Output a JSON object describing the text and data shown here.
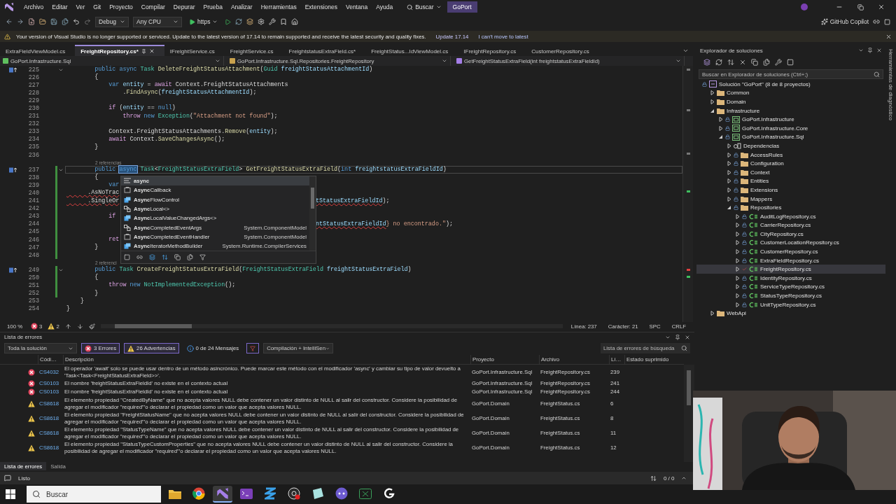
{
  "menu": {
    "items": [
      "Archivo",
      "Editar",
      "Ver",
      "Git",
      "Proyecto",
      "Compilar",
      "Depurar",
      "Prueba",
      "Analizar",
      "Herramientas",
      "Extensiones",
      "Ventana",
      "Ayuda"
    ],
    "search": "Buscar",
    "solution": "GoPort"
  },
  "toolbar": {
    "configuration": "Debug",
    "platform": "Any CPU",
    "run_target": "https",
    "copilot": "GitHub Copilot"
  },
  "info_bar": {
    "message": "Your version of Visual Studio is no longer supported or serviced. Update to the latest version of 17.14 to remain supported and receive the latest security and quality fixes.",
    "links": [
      "Update 17.14",
      "I can't move to latest"
    ]
  },
  "editor": {
    "tabs": [
      {
        "label": "ExtraFieldViewModel.cs",
        "selected": false
      },
      {
        "label": "FreightRepository.cs*",
        "selected": true
      },
      {
        "label": "IFreightService.cs",
        "selected": false
      },
      {
        "label": "FreightService.cs",
        "selected": false
      },
      {
        "label": "FreightstatusExtraField.cs*",
        "selected": false
      },
      {
        "label": "FreightStatus...IdViewModel.cs",
        "selected": false
      },
      {
        "label": "IFreightRepository.cs",
        "selected": false
      },
      {
        "label": "CustomerRepository.cs",
        "selected": false
      }
    ],
    "navigation": {
      "project": "GoPort.Infrastructure.Sql",
      "type": "GoPort.Infrastructure.Sql.Repositories.FreightRepository",
      "member": "GetFreightStatusExtraField(int freightstatusExtraFieldId)"
    },
    "lines": [
      {
        "kind": "code",
        "number": "225",
        "foldable": true,
        "changed": false,
        "current": false,
        "segments": [
          {
            "text": "        public async ",
            "kind": "kw"
          },
          {
            "text": "Task ",
            "kind": "type"
          },
          {
            "text": "DeleteFreightStatusAttachment",
            "kind": "method"
          },
          {
            "text": "(",
            "kind": "plain"
          },
          {
            "text": "Guid ",
            "kind": "type"
          },
          {
            "text": "freightStatusAttachmentId",
            "kind": "param"
          },
          {
            "text": ")",
            "kind": "plain"
          }
        ]
      },
      {
        "kind": "code",
        "number": "226",
        "foldable": false,
        "changed": false,
        "current": false,
        "segments": [
          {
            "text": "        {",
            "kind": "plain"
          }
        ]
      },
      {
        "kind": "code",
        "number": "227",
        "foldable": false,
        "changed": false,
        "current": false,
        "segments": [
          {
            "text": "            var ",
            "kind": "kw"
          },
          {
            "text": "entity",
            "kind": "param"
          },
          {
            "text": " = ",
            "kind": "plain"
          },
          {
            "text": "await ",
            "kind": "ctrl"
          },
          {
            "text": "Context.FreightStatusAttachments",
            "kind": "plain"
          }
        ]
      },
      {
        "kind": "code",
        "number": "228",
        "foldable": false,
        "changed": false,
        "current": false,
        "segments": [
          {
            "text": "                .",
            "kind": "plain"
          },
          {
            "text": "FindAsync",
            "kind": "method"
          },
          {
            "text": "(",
            "kind": "plain"
          },
          {
            "text": "freightStatusAttachmentId",
            "kind": "param"
          },
          {
            "text": ");",
            "kind": "plain"
          }
        ]
      },
      {
        "kind": "code",
        "number": "229",
        "foldable": false,
        "changed": false,
        "current": false
      },
      {
        "kind": "code",
        "number": "230",
        "foldable": false,
        "changed": false,
        "current": false,
        "segments": [
          {
            "text": "            if ",
            "kind": "ctrl"
          },
          {
            "text": "(",
            "kind": "plain"
          },
          {
            "text": "entity",
            "kind": "param"
          },
          {
            "text": " == ",
            "kind": "plain"
          },
          {
            "text": "null",
            "kind": "kw"
          },
          {
            "text": ")",
            "kind": "plain"
          }
        ]
      },
      {
        "kind": "code",
        "number": "231",
        "foldable": false,
        "changed": false,
        "current": false,
        "segments": [
          {
            "text": "                throw ",
            "kind": "ctrl"
          },
          {
            "text": "new ",
            "kind": "kw"
          },
          {
            "text": "Exception",
            "kind": "type"
          },
          {
            "text": "(",
            "kind": "plain"
          },
          {
            "text": "\"Attachment not found\"",
            "kind": "str"
          },
          {
            "text": ");",
            "kind": "plain"
          }
        ]
      },
      {
        "kind": "code",
        "number": "232",
        "foldable": false,
        "changed": false,
        "current": false
      },
      {
        "kind": "code",
        "number": "233",
        "foldable": false,
        "changed": false,
        "current": false,
        "segments": [
          {
            "text": "            Context.FreightStatusAttachments.",
            "kind": "plain"
          },
          {
            "text": "Remove",
            "kind": "method"
          },
          {
            "text": "(",
            "kind": "plain"
          },
          {
            "text": "entity",
            "kind": "param"
          },
          {
            "text": ");",
            "kind": "plain"
          }
        ]
      },
      {
        "kind": "code",
        "number": "234",
        "foldable": false,
        "changed": false,
        "current": false,
        "segments": [
          {
            "text": "            await ",
            "kind": "ctrl"
          },
          {
            "text": "Context.",
            "kind": "plain"
          },
          {
            "text": "SaveChangesAsync",
            "kind": "method"
          },
          {
            "text": "();",
            "kind": "plain"
          }
        ]
      },
      {
        "kind": "code",
        "number": "235",
        "foldable": false,
        "changed": false,
        "current": false,
        "segments": [
          {
            "text": "        }",
            "kind": "plain"
          }
        ]
      },
      {
        "kind": "code",
        "number": "236",
        "foldable": false,
        "changed": false,
        "current": false
      },
      {
        "kind": "codelens",
        "text": "2 referencias"
      },
      {
        "kind": "code",
        "number": "237",
        "foldable": true,
        "changed": true,
        "current": true,
        "segments": [
          {
            "text": "        public ",
            "kind": "kw"
          },
          {
            "text": "async",
            "kind": "selection"
          },
          {
            "text": " Task",
            "kind": "type"
          },
          {
            "text": "<",
            "kind": "plain"
          },
          {
            "text": "FreightStatusExtraField",
            "kind": "type"
          },
          {
            "text": "> ",
            "kind": "plain"
          },
          {
            "text": "GetFreightStatusExtraField",
            "kind": "method"
          },
          {
            "text": "(",
            "kind": "plain"
          },
          {
            "text": "int ",
            "kind": "kw"
          },
          {
            "text": "freightstatusExtraFieldId",
            "kind": "param"
          },
          {
            "text": ")",
            "kind": "plain"
          }
        ]
      },
      {
        "kind": "code",
        "number": "238",
        "foldable": false,
        "changed": true,
        "current": false,
        "segments": [
          {
            "text": "        {",
            "kind": "plain"
          }
        ]
      },
      {
        "kind": "code",
        "number": "239",
        "foldable": false,
        "changed": true,
        "current": false,
        "segments": [
          {
            "text": "            var",
            "kind": "kw"
          }
        ]
      },
      {
        "kind": "code",
        "number": "240",
        "foldable": false,
        "changed": true,
        "current": false,
        "segments": [
          {
            "text": "      .AsNoTrac",
            "kind": "error"
          }
        ]
      },
      {
        "kind": "code",
        "number": "241",
        "foldable": false,
        "changed": true,
        "current": false,
        "segments": [
          {
            "text": "      .SingleOr",
            "kind": "error"
          }
        ],
        "after_popup": [
          {
            "text": "tStatusExtraFieldId",
            "kind": "error-param"
          },
          {
            "text": ");",
            "kind": "plain"
          }
        ]
      },
      {
        "kind": "code",
        "number": "242",
        "foldable": false,
        "changed": true,
        "current": false
      },
      {
        "kind": "code",
        "number": "243",
        "foldable": false,
        "changed": true,
        "current": false,
        "segments": [
          {
            "text": "            if",
            "kind": "ctrl"
          }
        ]
      },
      {
        "kind": "code",
        "number": "244",
        "foldable": false,
        "changed": true,
        "current": false,
        "after_popup": [
          {
            "text": "ntStatusExtraFieldId",
            "kind": "error-param"
          },
          {
            "text": "} no encontrado.\"",
            "kind": "str"
          },
          {
            "text": ");",
            "kind": "plain"
          }
        ]
      },
      {
        "kind": "code",
        "number": "245",
        "foldable": false,
        "changed": true,
        "current": false
      },
      {
        "kind": "code",
        "number": "246",
        "foldable": false,
        "changed": true,
        "current": false,
        "segments": [
          {
            "text": "            ret",
            "kind": "ctrl"
          }
        ]
      },
      {
        "kind": "code",
        "number": "247",
        "foldable": false,
        "changed": true,
        "current": false,
        "segments": [
          {
            "text": "        }",
            "kind": "plain"
          }
        ]
      },
      {
        "kind": "code",
        "number": "248",
        "foldable": false,
        "changed": true,
        "current": false
      },
      {
        "kind": "codelens",
        "text": "2 referenci"
      },
      {
        "kind": "code",
        "number": "249",
        "foldable": true,
        "changed": true,
        "current": false,
        "segments": [
          {
            "text": "        public ",
            "kind": "kw"
          },
          {
            "text": "Task ",
            "kind": "type"
          },
          {
            "text": "CreateFreightStatusExtraField",
            "kind": "method"
          },
          {
            "text": "(",
            "kind": "plain"
          },
          {
            "text": "FreightStatusExtraField ",
            "kind": "type"
          },
          {
            "text": "freightStatusExtraField",
            "kind": "param"
          },
          {
            "text": ")",
            "kind": "plain"
          }
        ]
      },
      {
        "kind": "code",
        "number": "250",
        "foldable": false,
        "changed": true,
        "current": false,
        "segments": [
          {
            "text": "        {",
            "kind": "plain"
          }
        ]
      },
      {
        "kind": "code",
        "number": "251",
        "foldable": false,
        "changed": true,
        "current": false,
        "segments": [
          {
            "text": "            throw ",
            "kind": "ctrl"
          },
          {
            "text": "new ",
            "kind": "kw"
          },
          {
            "text": "NotImplementedException",
            "kind": "type"
          },
          {
            "text": "();",
            "kind": "plain"
          }
        ]
      },
      {
        "kind": "code",
        "number": "252",
        "foldable": false,
        "changed": true,
        "current": false,
        "segments": [
          {
            "text": "        }",
            "kind": "plain"
          }
        ]
      },
      {
        "kind": "code",
        "number": "253",
        "foldable": false,
        "changed": false,
        "current": false,
        "segments": [
          {
            "text": "    }",
            "kind": "plain"
          }
        ]
      },
      {
        "kind": "code",
        "number": "254",
        "foldable": false,
        "changed": false,
        "current": false,
        "segments": [
          {
            "text": "}",
            "kind": "plain"
          }
        ]
      }
    ],
    "completion": {
      "items": [
        {
          "name": "**async**",
          "kind": "keyword",
          "selected": true
        },
        {
          "name": "**Async**Callback",
          "kind": "delegate",
          "selected": false
        },
        {
          "name": "**Async**FlowControl",
          "kind": "struct",
          "selected": false
        },
        {
          "name": "**Async**Local<>",
          "kind": "class",
          "selected": false
        },
        {
          "name": "**Async**LocalValueChangedArgs<>",
          "kind": "struct",
          "selected": false
        },
        {
          "name": "**Async**CompletedEventArgs",
          "kind": "class",
          "selected": false,
          "namespace": "System.ComponentModel"
        },
        {
          "name": "**Async**CompletedEventHandler",
          "kind": "delegate",
          "selected": false,
          "namespace": "System.ComponentModel"
        },
        {
          "name": "**Async**IteratorMethodBuilder",
          "kind": "struct",
          "selected": false,
          "namespace": "System.Runtime.CompilerServices"
        }
      ]
    },
    "status": {
      "zoom": "100 %",
      "errors": "3",
      "warnings": "2",
      "line": "Línea: 237",
      "column": "Carácter: 21",
      "indent": "SPC",
      "line_ending": "CRLF"
    }
  },
  "solution_explorer": {
    "title": "Explorador de soluciones",
    "search_placeholder": "Buscar en Explorador de soluciones (Ctrl+;)",
    "root": {
      "label": "Solución \"GoPort\" (8 de 8 proyectos)",
      "kind": "solution",
      "checked_in": true,
      "selected": false,
      "children": [
        {
          "label": "Common",
          "kind": "folder",
          "expanded": false,
          "selected": false
        },
        {
          "label": "Domain",
          "kind": "folder",
          "expanded": false,
          "selected": false
        },
        {
          "label": "Infrastructure",
          "kind": "folder",
          "expanded": true,
          "selected": false,
          "children": [
            {
              "label": "GoPort.Infrastructure",
              "kind": "project",
              "checked_in": true,
              "expanded": false,
              "selected": false
            },
            {
              "label": "GoPort.Infrastructure.Core",
              "kind": "project",
              "checked_in": true,
              "expanded": false,
              "selected": false
            },
            {
              "label": "GoPort.Infrastructure.Sql",
              "kind": "project",
              "checked_in": true,
              "expanded": true,
              "selected": false,
              "children": [
                {
                  "label": "Dependencias",
                  "kind": "dependencies",
                  "expanded": false,
                  "selected": false
                },
                {
                  "label": "AccessRules",
                  "kind": "folder",
                  "checked_in": true,
                  "expanded": false,
                  "selected": false
                },
                {
                  "label": "Configuration",
                  "kind": "folder",
                  "checked_in": true,
                  "expanded": false,
                  "selected": false
                },
                {
                  "label": "Context",
                  "kind": "folder",
                  "checked_in": true,
                  "expanded": false,
                  "selected": false
                },
                {
                  "label": "Entities",
                  "kind": "folder",
                  "checked_in": true,
                  "expanded": false,
                  "selected": false
                },
                {
                  "label": "Extensions",
                  "kind": "folder",
                  "checked_in": true,
                  "expanded": false,
                  "selected": false
                },
                {
                  "label": "Mappers",
                  "kind": "folder",
                  "checked_in": true,
                  "expanded": false,
                  "selected": false
                },
                {
                  "label": "Repositories",
                  "kind": "folder",
                  "checked_in": true,
                  "expanded": true,
                  "selected": false,
                  "children": [
                    {
                      "label": "AuditLogRepository.cs",
                      "kind": "csharp",
                      "checked_in": true,
                      "expanded": false,
                      "selected": false
                    },
                    {
                      "label": "CarrierRepository.cs",
                      "kind": "csharp",
                      "checked_in": true,
                      "expanded": false,
                      "selected": false
                    },
                    {
                      "label": "CityRepository.cs",
                      "kind": "csharp",
                      "checked_in": true,
                      "expanded": false,
                      "selected": false
                    },
                    {
                      "label": "CustomerLocationRepository.cs",
                      "kind": "csharp",
                      "checked_in": true,
                      "expanded": false,
                      "selected": false
                    },
                    {
                      "label": "CustomerRepository.cs",
                      "kind": "csharp",
                      "checked_in": true,
                      "expanded": false,
                      "selected": false
                    },
                    {
                      "label": "ExtraFieldRepository.cs",
                      "kind": "csharp",
                      "checked_in": true,
                      "expanded": false,
                      "selected": false
                    },
                    {
                      "label": "FreightRepository.cs",
                      "kind": "csharp",
                      "checked_in": false,
                      "expanded": false,
                      "selected": true
                    },
                    {
                      "label": "IdentityRepository.cs",
                      "kind": "csharp",
                      "checked_in": true,
                      "expanded": false,
                      "selected": false
                    },
                    {
                      "label": "ServiceTypeRepository.cs",
                      "kind": "csharp",
                      "checked_in": true,
                      "expanded": false,
                      "selected": false
                    },
                    {
                      "label": "StatusTypeRepository.cs",
                      "kind": "csharp",
                      "checked_in": true,
                      "expanded": false,
                      "selected": false
                    },
                    {
                      "label": "UnitTypeRepository.cs",
                      "kind": "csharp",
                      "checked_in": true,
                      "expanded": false,
                      "selected": false
                    }
                  ]
                }
              ]
            }
          ]
        },
        {
          "label": "WebApi",
          "kind": "folder",
          "expanded": false,
          "selected": false
        }
      ]
    }
  },
  "side_strip": {
    "label": "Herramientas de diagnóstico"
  },
  "error_list": {
    "title": "Lista de errores",
    "scope": "Toda la solución",
    "filters": [
      {
        "label": "3 Errores",
        "kind": "error",
        "selected": true
      },
      {
        "label": "26 Advertencias",
        "kind": "warning",
        "selected": true
      },
      {
        "label": "0 de 24 Mensajes",
        "kind": "info",
        "selected": false
      }
    ],
    "source": "Compilación + IntelliSen",
    "search_placeholder": "Lista de errores de búsqueda",
    "columns": [
      "Códi…",
      "Descripción",
      "Proyecto",
      "Archivo",
      "Lí…",
      "Estado suprimido"
    ],
    "rows": [
      {
        "kind": "error",
        "code": "CS4032",
        "description": "El operador 'await' solo se puede usar dentro de un método asincrónico. Puede marcar este método con el modificador 'async' y cambiar su tipo de valor devuelto a 'Task<Task<FreightStatusExtraField>>'.",
        "project": "GoPort.Infrastructure.Sql",
        "file": "FreightRepository.cs",
        "line": "239"
      },
      {
        "kind": "error",
        "code": "CS0103",
        "description": "El nombre 'freightStatusExtraFieldId' no existe en el contexto actual",
        "project": "GoPort.Infrastructure.Sql",
        "file": "FreightRepository.cs",
        "line": "241"
      },
      {
        "kind": "error",
        "code": "CS0103",
        "description": "El nombre 'freightStatusExtraFieldId' no existe en el contexto actual",
        "project": "GoPort.Infrastructure.Sql",
        "file": "FreightRepository.cs",
        "line": "244"
      },
      {
        "kind": "warning",
        "code": "CS8618",
        "description": "El elemento propiedad \"CreatedByName\" que no acepta valores NULL debe contener un valor distinto de NULL al salir del constructor. Considere la posibilidad de agregar el modificador \"required\"'o declarar el propiedad como un valor que acepta valores NULL.",
        "project": "GoPort.Domain",
        "file": "FreightStatus.cs",
        "line": "6"
      },
      {
        "kind": "warning",
        "code": "CS8618",
        "description": "El elemento propiedad \"FreightStatusName\" que no acepta valores NULL debe contener un valor distinto de NULL al salir del constructor. Considere la posibilidad de agregar el modificador \"required\"'o declarar el propiedad como un valor que acepta valores NULL.",
        "project": "GoPort.Domain",
        "file": "FreightStatus.cs",
        "line": "8"
      },
      {
        "kind": "warning",
        "code": "CS8618",
        "description": "El elemento propiedad \"StatusTypeName\" que no acepta valores NULL debe contener un valor distinto de NULL al salir del constructor. Considere la posibilidad de agregar el modificador \"required\"'o declarar el propiedad como un valor que acepta valores NULL.",
        "project": "GoPort.Domain",
        "file": "FreightStatus.cs",
        "line": "11"
      },
      {
        "kind": "warning",
        "code": "CS8618",
        "description": "El elemento propiedad \"StatusTypeCustomProperties\" que no acepta valores NULL debe contener un valor distinto de NULL al salir del constructor. Considere la posibilidad de agregar el modificador \"required\"'o declarar el propiedad como un valor que acepta valores NULL.",
        "project": "GoPort.Domain",
        "file": "FreightStatus.cs",
        "line": "12"
      }
    ],
    "tabs": [
      {
        "label": "Lista de errores",
        "selected": true
      },
      {
        "label": "Salida",
        "selected": false
      }
    ]
  },
  "status_bar": {
    "text": "Listo",
    "position": "0 / 0"
  },
  "taskbar": {
    "search_placeholder": "Buscar",
    "apps": [
      {
        "kind": "folder",
        "selected": false
      },
      {
        "kind": "browser",
        "selected": false
      },
      {
        "kind": "studio",
        "selected": true
      },
      {
        "kind": "terminal",
        "selected": false
      },
      {
        "kind": "stack",
        "selected": false
      },
      {
        "kind": "record",
        "selected": false
      },
      {
        "kind": "notes",
        "selected": false
      },
      {
        "kind": "chat",
        "selected": false
      },
      {
        "kind": "sheet",
        "selected": false
      },
      {
        "kind": "hook",
        "selected": false
      }
    ]
  }
}
